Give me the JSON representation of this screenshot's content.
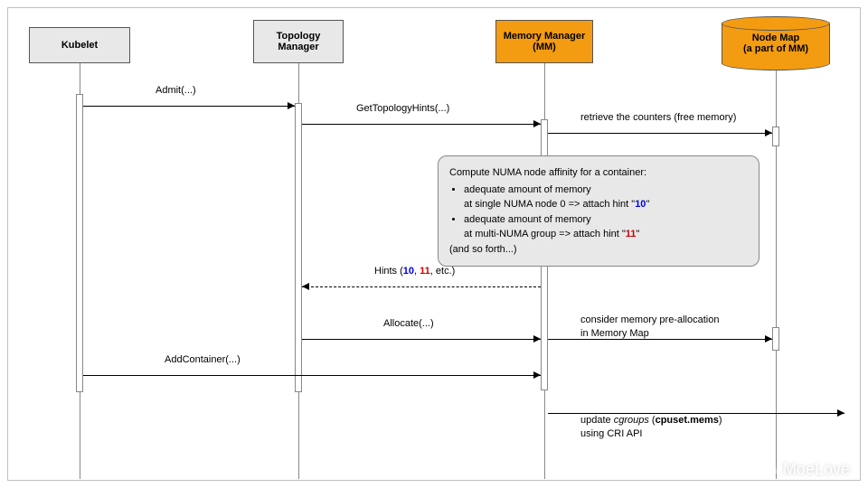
{
  "participants": {
    "kubelet": "Kubelet",
    "topology": "Topology\nManager",
    "memory": "Memory Manager\n(MM)",
    "nodemap": "Node Map\n(a part of MM)"
  },
  "messages": {
    "admit": "Admit(...)",
    "getHints": "GetTopologyHints(...)",
    "retrieve": "retrieve the counters (free memory)",
    "hintsReturnPrefix": "Hints (",
    "hintsReturnSuffix": ", etc.)",
    "allocate": "Allocate(...)",
    "addContainer": "AddContainer(...)"
  },
  "note": {
    "title": "Compute NUMA node affinity for a container:",
    "b1a": "adequate amount of memory",
    "b1b": "at single NUMA node 0 => attach hint \"",
    "b1c": "\"",
    "b2a": "adequate amount of memory",
    "b2b": "at multi-NUMA group => attach hint \"",
    "b2c": "\"",
    "tail": "(and so forth...)"
  },
  "sideNotes": {
    "prealloc1": "consider memory pre-allocation",
    "prealloc2": "in Memory Map",
    "updateA": "update ",
    "updateB": "cgroups",
    "updateC": " (",
    "updateD": "cpuset.mems",
    "updateE": ")",
    "update2": "using CRI API"
  },
  "hints": {
    "h10": "10",
    "h11": "11"
  },
  "watermark": "MoeLove",
  "chart_data": {
    "type": "table",
    "description": "UML sequence diagram",
    "participants": [
      "Kubelet",
      "Topology Manager",
      "Memory Manager (MM)",
      "Node Map (a part of MM)"
    ],
    "interactions": [
      {
        "from": "Kubelet",
        "to": "Topology Manager",
        "label": "Admit(...)",
        "style": "sync"
      },
      {
        "from": "Topology Manager",
        "to": "Memory Manager",
        "label": "GetTopologyHints(...)",
        "style": "sync"
      },
      {
        "from": "Memory Manager",
        "to": "Node Map",
        "label": "retrieve the counters (free memory)",
        "style": "sync"
      },
      {
        "from": "Memory Manager",
        "to": "Memory Manager",
        "label": "Compute NUMA node affinity for a container: adequate amount of memory at single NUMA node 0 => attach hint \"10\"; adequate amount of memory at multi-NUMA group => attach hint \"11\"; (and so forth...)",
        "style": "self-note"
      },
      {
        "from": "Memory Manager",
        "to": "Topology Manager",
        "label": "Hints (10, 11, etc.)",
        "style": "return"
      },
      {
        "from": "Topology Manager",
        "to": "Memory Manager",
        "label": "Allocate(...)",
        "style": "sync",
        "note": "consider memory pre-allocation in Memory Map"
      },
      {
        "from": "Kubelet",
        "to": "Memory Manager",
        "label": "AddContainer(...)",
        "style": "sync"
      },
      {
        "from": "Memory Manager",
        "to": "(external)",
        "label": "update cgroups (cpuset.mems) using CRI API",
        "style": "sync"
      }
    ]
  }
}
